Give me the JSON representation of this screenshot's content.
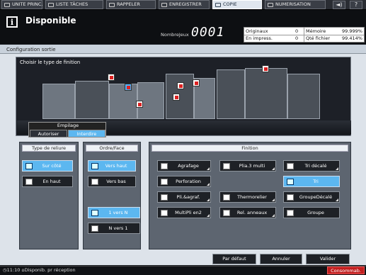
{
  "top_tabs": [
    {
      "label": "UNITE PRINC.",
      "icon": "home-icon"
    },
    {
      "label": "LISTE TÂCHES",
      "icon": "job-list-icon"
    },
    {
      "label": "RAPPELER",
      "icon": "recall-icon"
    },
    {
      "label": "ENREGISTRER",
      "icon": "save-icon"
    },
    {
      "label": "COPIE",
      "icon": "copy-icon"
    },
    {
      "label": "NUMERISATION",
      "icon": "scan-icon"
    }
  ],
  "top_icons": {
    "volume": "◄)",
    "help": "?"
  },
  "header": {
    "status": "Disponible",
    "njeux_label": "NombreJeux",
    "njeux_value": "0001"
  },
  "counters": {
    "originaux_label": "Originaux",
    "originaux_value": "0",
    "memoire_label": "Mémoire",
    "memoire_value": "99.999%",
    "impress_label": "En impress.",
    "impress_value": "0",
    "qte_label": "Qté fichier",
    "qte_value": "99.414%"
  },
  "config_title": "Configuration sortie",
  "preview": {
    "prompt": "Choisir le type de finition"
  },
  "empilage": {
    "title": "Empilage",
    "autoriser": "Autoriser",
    "interdire": "Interdire"
  },
  "reliure": {
    "title": "Type de reliure",
    "sur_cote": "Sur côté",
    "en_haut": "En haut"
  },
  "ordre": {
    "title": "Ordre/Face",
    "vers_haut": "Vers haut",
    "vers_bas": "Vers bas",
    "un_vers_n": "1 vers N",
    "n_vers_1": "N vers 1"
  },
  "finition": {
    "title": "Finition",
    "col1": [
      "Agrafage",
      "Perforation",
      "Pli.&agraf.",
      "MultiPli en2"
    ],
    "col2": [
      "Plia.3 multi",
      "Thermorelier",
      "Rel. anneaux"
    ],
    "col3": [
      "Tri décalé",
      "Tri",
      "GroupeDécalé",
      "Groupe"
    ]
  },
  "bottom": {
    "par_defaut": "Par défaut",
    "annuler": "Annuler",
    "valider": "Valider"
  },
  "statusbar": {
    "time": "11:10",
    "message": "Disponib. pr réception",
    "conso": "Consommab."
  },
  "colors": {
    "accent": "#5cb7f0",
    "alert": "#c21f1f"
  }
}
